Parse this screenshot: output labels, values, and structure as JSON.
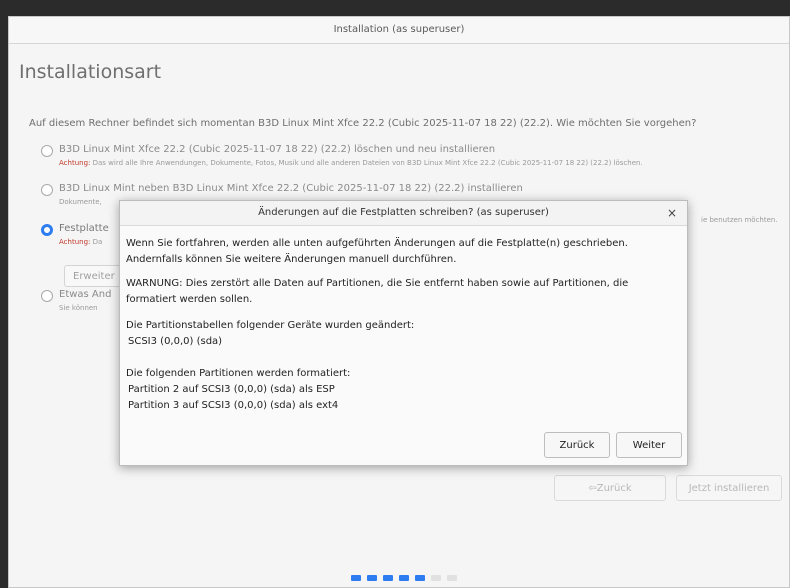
{
  "window": {
    "title": "Installation (as superuser)"
  },
  "page": {
    "title": "Installationsart",
    "question": "Auf diesem Rechner befindet sich momentan B3D Linux Mint Xfce 22.2 (Cubic 2025-11-07 18 22) (22.2). Wie möchten Sie vorgehen?"
  },
  "options": [
    {
      "label": "B3D Linux Mint Xfce 22.2 (Cubic 2025-11-07 18 22) (22.2) löschen und neu installieren",
      "warn": "Achtung:",
      "desc": " Das wird alle Ihre Anwendungen, Dokumente, Fotos, Musik und alle anderen Dateien von B3D Linux Mint Xfce 22.2 (Cubic 2025-11-07 18 22) (22.2) löschen.",
      "selected": false
    },
    {
      "label": "B3D Linux Mint neben B3D Linux Mint Xfce 22.2 (Cubic 2025-11-07 18 22) (22.2) installieren",
      "desc": "Dokumente,",
      "desc_right": "ie benutzen möchten.",
      "selected": false
    },
    {
      "label": "Festplatte",
      "warn": "Achtung:",
      "desc": " Da",
      "selected": true
    },
    {
      "label": "Etwas And",
      "desc": "Sie können",
      "selected": false
    }
  ],
  "advanced_button": "Erweiter",
  "nav": {
    "back": "Zurück",
    "back_icon": "back-arrow-icon",
    "install": "Jetzt installieren"
  },
  "progress": {
    "total": 7,
    "done": 5
  },
  "dialog": {
    "title": "Änderungen auf die Festplatten schreiben? (as superuser)",
    "close": "×",
    "p1": "Wenn Sie fortfahren, werden alle unten aufgeführten Änderungen auf die Festplatte(n) geschrieben. Andernfalls können Sie weitere Änderungen manuell durchführen.",
    "p2": "WARNUNG: Dies zerstört alle Daten auf Partitionen, die Sie entfernt haben sowie auf Partitionen, die formatiert werden sollen.",
    "p3_head": "Die Partitionstabellen folgender Geräte wurden geändert:",
    "p3_items": [
      "SCSI3 (0,0,0) (sda)"
    ],
    "p4_head": "Die folgenden Partitionen werden formatiert:",
    "p4_items": [
      "Partition 2 auf SCSI3 (0,0,0) (sda) als ESP",
      "Partition 3 auf SCSI3 (0,0,0) (sda) als ext4"
    ],
    "back": "Zurück",
    "next": "Weiter"
  },
  "colors": {
    "accent": "#2d7df0",
    "warning": "#c0392b"
  }
}
